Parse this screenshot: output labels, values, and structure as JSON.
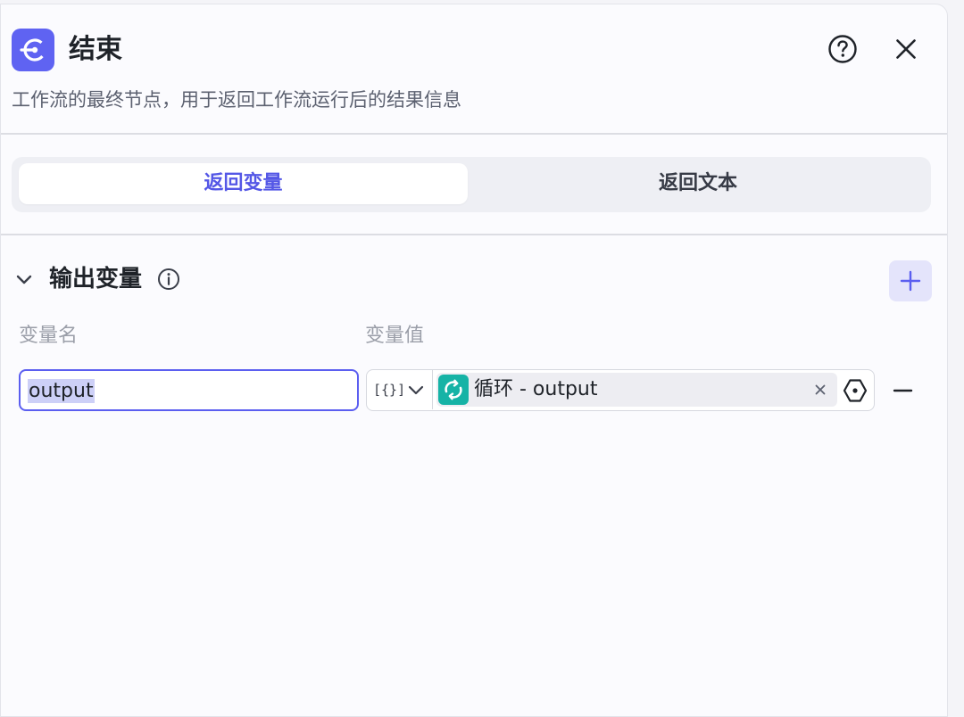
{
  "node": {
    "title": "结束",
    "description": "工作流的最终节点，用于返回工作流运行后的结果信息",
    "icon": "end-node-icon",
    "accent_color": "#5f63f2"
  },
  "header_actions": {
    "help_icon": "question-circle-icon",
    "close_icon": "close-icon"
  },
  "tabs": [
    {
      "label": "返回变量",
      "active": true
    },
    {
      "label": "返回文本",
      "active": false
    }
  ],
  "output_section": {
    "title": "输出变量",
    "columns": {
      "name": "变量名",
      "value": "变量值"
    },
    "rows": [
      {
        "name": "output",
        "type_symbol": "[{}]",
        "reference": {
          "label": "循环 - output",
          "icon": "loop-icon",
          "icon_color": "#16b3a6"
        }
      }
    ]
  },
  "colors": {
    "primary": "#5b5ef0",
    "active_tab_text": "#5457e6",
    "muted_text": "#9a9ea8"
  }
}
